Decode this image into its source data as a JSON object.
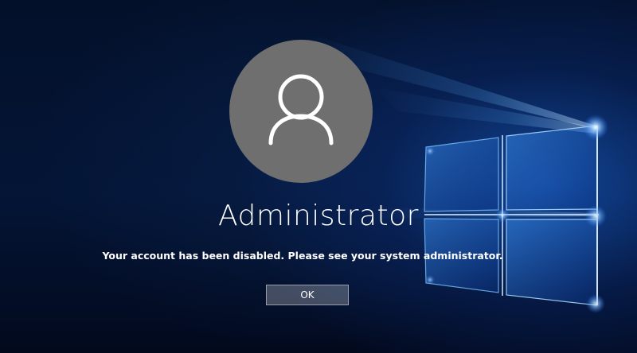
{
  "lock_screen": {
    "username": "Administrator",
    "message": "Your account has been disabled. Please see your system administrator.",
    "ok_label": "OK",
    "avatar_icon": "user-icon"
  },
  "colors": {
    "avatar_background": "#6f6f6f",
    "text": "#ffffff",
    "background_dark": "#03102a",
    "glow_blue": "#1e6ee6"
  }
}
